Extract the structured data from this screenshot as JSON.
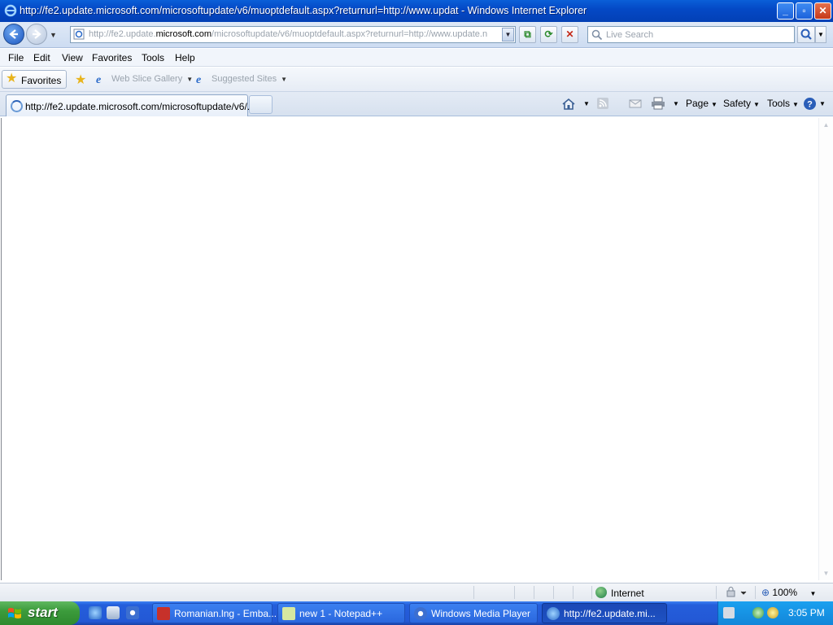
{
  "window": {
    "title": "http://fe2.update.microsoft.com/microsoftupdate/v6/muoptdefault.aspx?returnurl=http://www.updat - Windows Internet Explorer",
    "buttons": {
      "minimize": "_",
      "maximize": "▫",
      "close": "✕"
    }
  },
  "address": {
    "url_prefix": "http://fe2.update.",
    "url_domain": "microsoft.com",
    "url_suffix": "/microsoftupdate/v6/muoptdefault.aspx?returnurl=http://www.update.n"
  },
  "search": {
    "placeholder": "Live Search"
  },
  "menu": {
    "items": [
      "File",
      "Edit",
      "View",
      "Favorites",
      "Tools",
      "Help"
    ]
  },
  "favorites_bar": {
    "favorites_label": "Favorites",
    "web_slice_gallery": "Web Slice Gallery",
    "suggested_sites": "Suggested Sites"
  },
  "tab": {
    "title": "http://fe2.update.microsoft.com/microsoftupdate/v6/..."
  },
  "command_bar": {
    "page": "Page",
    "safety": "Safety",
    "tools": "Tools"
  },
  "status": {
    "zone": "Internet",
    "zoom": "100%"
  },
  "taskbar": {
    "start": "start",
    "tasks": [
      {
        "label": "Romanian.lng - Emba..."
      },
      {
        "label": "new 1 - Notepad++"
      },
      {
        "label": "Windows Media Player"
      },
      {
        "label": "http://fe2.update.mi..."
      }
    ],
    "clock": "3:05 PM"
  },
  "colors": {
    "titlebar": "#0449c6",
    "taskbar": "#245edb",
    "start_button": "#3c9b3c",
    "tray": "#1386d9"
  }
}
